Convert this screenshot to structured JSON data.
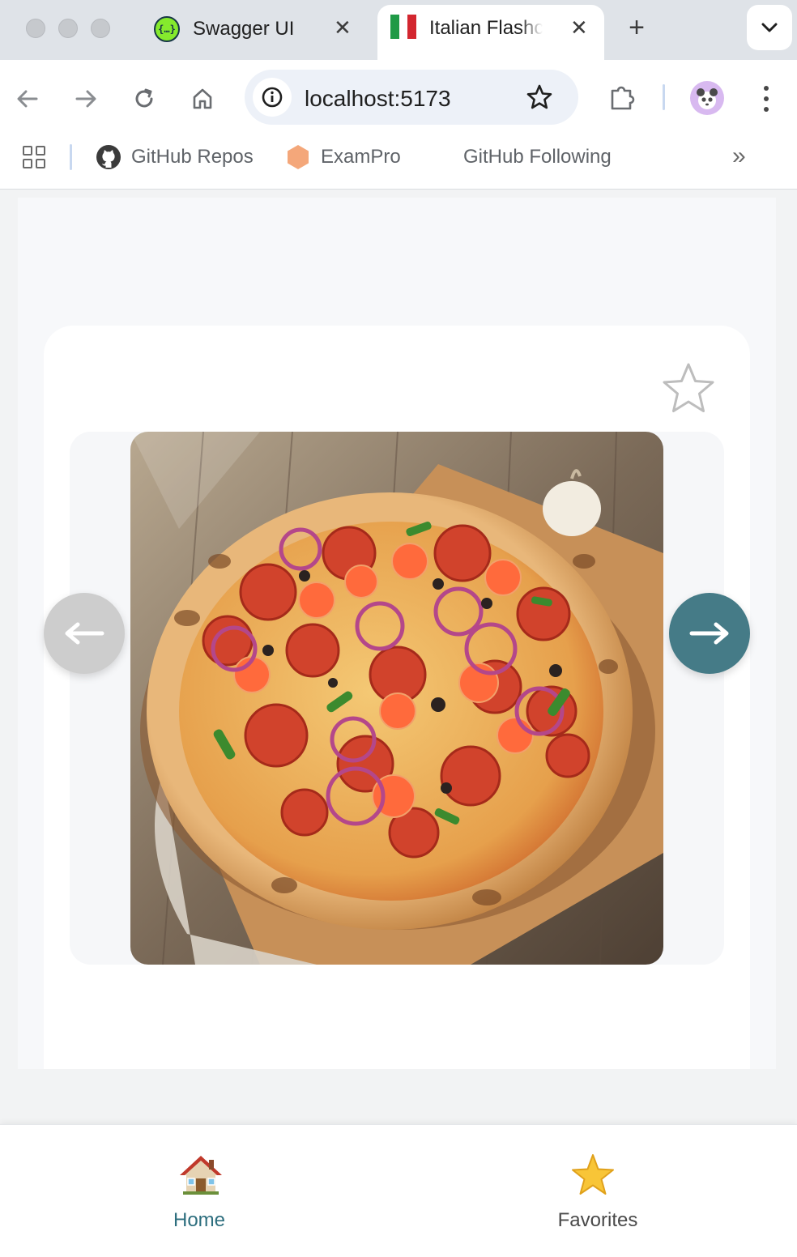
{
  "browser": {
    "tabs": [
      {
        "title": "Swagger UI",
        "favicon": "swagger-icon",
        "close": "✕",
        "active": false
      },
      {
        "title": "Italian Flashcards",
        "favicon": "italian-flag-icon",
        "close": "✕",
        "active": true
      }
    ],
    "new_tab": "+",
    "address": "localhost:5173",
    "bookmarks": [
      {
        "label": "GitHub Repos",
        "icon": "github-icon"
      },
      {
        "label": "ExamPro",
        "icon": "hexagon-icon"
      },
      {
        "label": "GitHub Following",
        "icon": ""
      }
    ],
    "bookmarks_overflow": "»"
  },
  "flashcard": {
    "image_alt_icon": "pizza-image",
    "is_favorite": false,
    "prev_enabled": false,
    "next_enabled": true
  },
  "bottom_nav": {
    "items": [
      {
        "label": "Home",
        "icon": "house-icon",
        "active": true
      },
      {
        "label": "Favorites",
        "icon": "star-icon",
        "active": false
      }
    ]
  },
  "colors": {
    "accent": "#457b87",
    "nav_active": "#2d6e7e",
    "disabled": "#cdcdcd"
  }
}
